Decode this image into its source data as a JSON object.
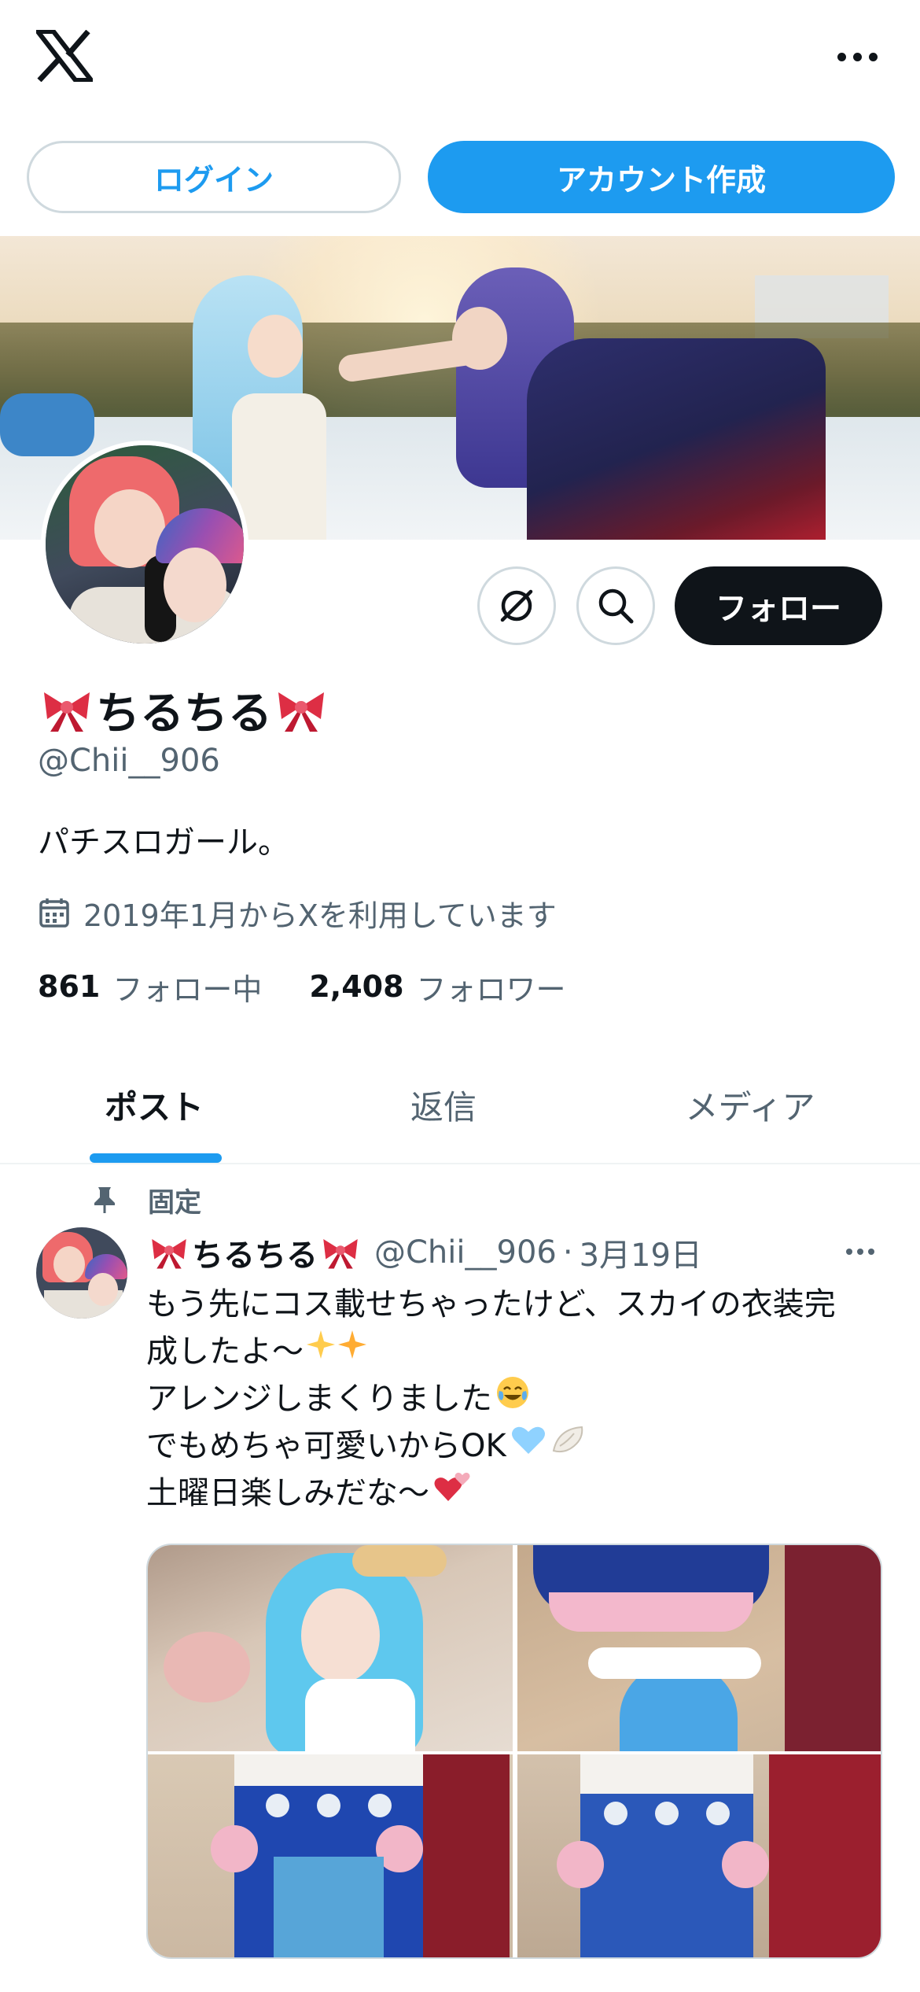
{
  "header": {
    "logo_icon": "x-logo-icon",
    "more_icon": "more-horizontal-icon"
  },
  "auth": {
    "login_label": "ログイン",
    "signup_label": "アカウント作成",
    "accent": "#1d9bf0"
  },
  "profile": {
    "display_name": "ちるちる",
    "name_decoration_icon": "ribbon-emoji",
    "handle": "@Chii__906",
    "bio": "パチスロガール。",
    "joined": "2019年1月からXを利用しています",
    "following_count": "861",
    "following_label": "フォロー中",
    "followers_count": "2,408",
    "followers_label": "フォロワー",
    "follow_button": "フォロー",
    "grok_icon": "grok-icon",
    "search_icon": "search-icon"
  },
  "tabs": [
    {
      "label": "ポスト",
      "active": true
    },
    {
      "label": "返信",
      "active": false
    },
    {
      "label": "メディア",
      "active": false
    }
  ],
  "pinned_post": {
    "pinned_label": "固定",
    "author_name": "ちるちる",
    "author_handle": "@Chii__906",
    "separator": "·",
    "date": "3月19日",
    "lines": [
      "もう先にコス載せちゃったけど、スカイの衣装完",
      "成したよ〜",
      "アレンジしまくりました",
      "でもめちゃ可愛いからOK",
      "土曜日楽しみだな〜"
    ],
    "line_emoji": [
      "",
      "sparkles-emoji",
      "tears-of-joy-emoji",
      "blue-heart-wing-emoji",
      "two-hearts-emoji"
    ],
    "media_count": 4
  },
  "colors": {
    "text_primary": "#0f1419",
    "text_secondary": "#536471",
    "border": "#cfd9de",
    "follow_bg": "#0f1419"
  }
}
